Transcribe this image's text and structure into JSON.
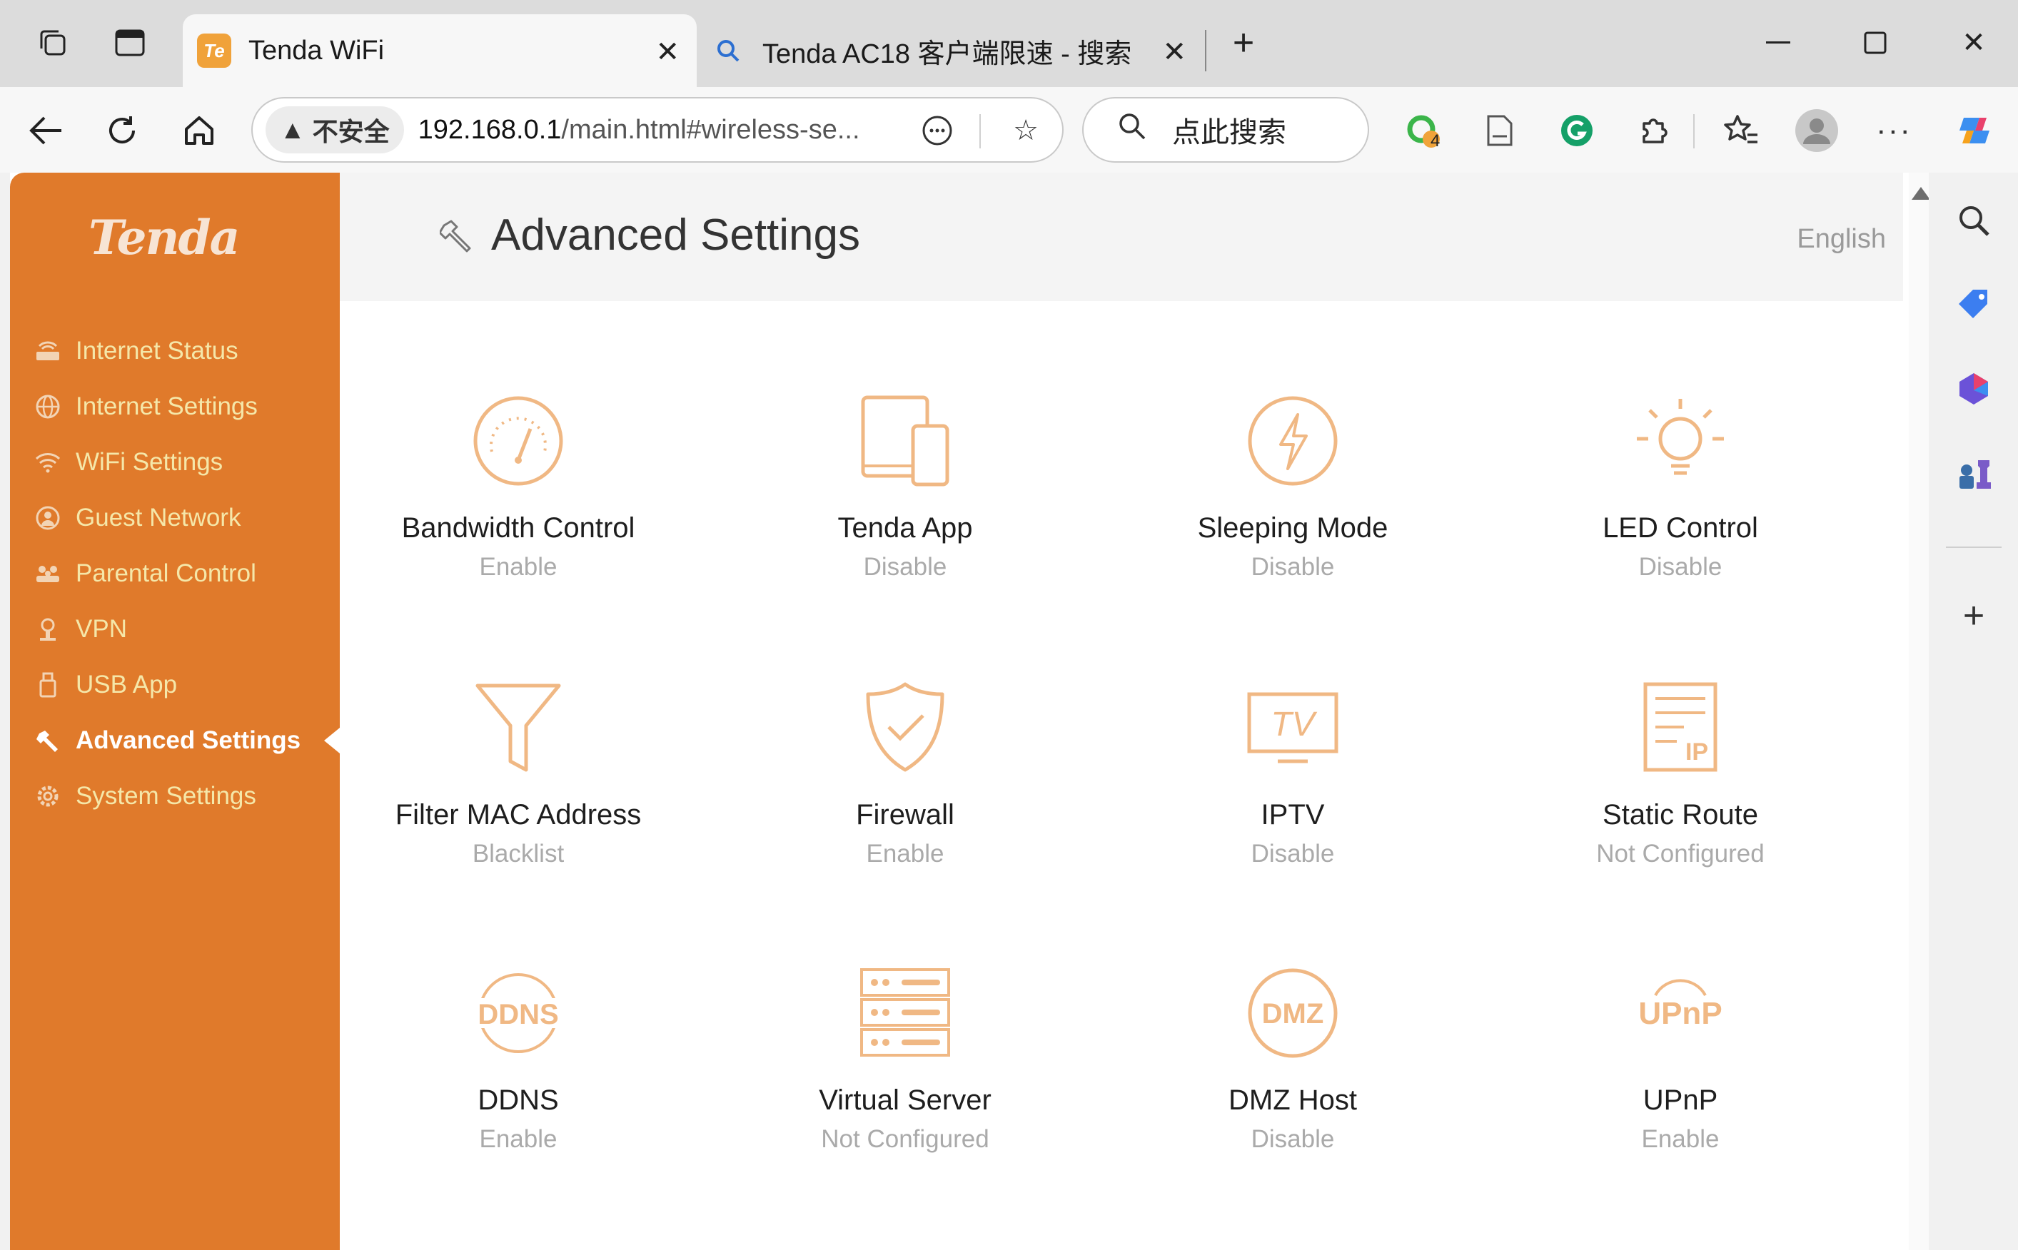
{
  "browser": {
    "tabs": [
      {
        "title": "Tenda WiFi",
        "active": true
      },
      {
        "title": "Tenda AC18 客户端限速 - 搜索",
        "active": false
      }
    ],
    "address": {
      "security_label": "不安全",
      "url_host": "192.168.0.1",
      "url_path": "/main.html#wireless-se..."
    },
    "search_placeholder": "点此搜索",
    "extension_badge": "4"
  },
  "sidebar": {
    "logo": "Tenda",
    "items": [
      {
        "label": "Internet Status",
        "icon": "router-icon"
      },
      {
        "label": "Internet Settings",
        "icon": "globe-icon"
      },
      {
        "label": "WiFi Settings",
        "icon": "wifi-icon"
      },
      {
        "label": "Guest Network",
        "icon": "guest-icon"
      },
      {
        "label": "Parental Control",
        "icon": "family-icon"
      },
      {
        "label": "VPN",
        "icon": "vpn-icon"
      },
      {
        "label": "USB App",
        "icon": "usb-icon"
      },
      {
        "label": "Advanced Settings",
        "icon": "wrench-icon",
        "active": true
      },
      {
        "label": "System Settings",
        "icon": "gear-icon"
      }
    ]
  },
  "header": {
    "title": "Advanced Settings",
    "language": "English"
  },
  "features": [
    {
      "name": "Bandwidth Control",
      "status": "Enable",
      "icon": "gauge-icon"
    },
    {
      "name": "Tenda App",
      "status": "Disable",
      "icon": "devices-icon"
    },
    {
      "name": "Sleeping Mode",
      "status": "Disable",
      "icon": "lightning-icon"
    },
    {
      "name": "LED Control",
      "status": "Disable",
      "icon": "bulb-icon"
    },
    {
      "name": "Filter MAC Address",
      "status": "Blacklist",
      "icon": "funnel-icon"
    },
    {
      "name": "Firewall",
      "status": "Enable",
      "icon": "shield-icon"
    },
    {
      "name": "IPTV",
      "status": "Disable",
      "icon": "tv-icon"
    },
    {
      "name": "Static Route",
      "status": "Not Configured",
      "icon": "route-list-icon"
    },
    {
      "name": "DDNS",
      "status": "Enable",
      "icon": "ddns-icon"
    },
    {
      "name": "Virtual Server",
      "status": "Not Configured",
      "icon": "server-icon"
    },
    {
      "name": "DMZ Host",
      "status": "Disable",
      "icon": "dmz-icon"
    },
    {
      "name": "UPnP",
      "status": "Enable",
      "icon": "upnp-icon"
    }
  ],
  "colors": {
    "sidebar_bg": "#e07a2b",
    "accent_icon": "#f0b884",
    "menu_text": "#f5e7a9"
  }
}
